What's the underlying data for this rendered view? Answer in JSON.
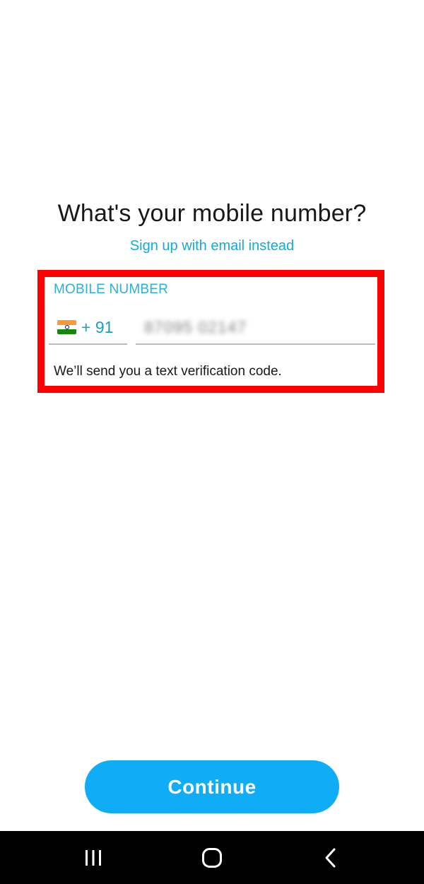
{
  "screen": {
    "title": "What's your mobile number?",
    "email_link": "Sign up with email instead"
  },
  "phone_form": {
    "label": "MOBILE NUMBER",
    "country_flag": "india-flag-icon",
    "country_code": "+ 91",
    "phone_value": "87095 02147",
    "helper_text": "We’ll send you a text verification code."
  },
  "actions": {
    "continue_label": "Continue"
  },
  "navbar": {
    "recent_icon": "recent-apps-icon",
    "home_icon": "home-icon",
    "back_icon": "back-icon"
  },
  "colors": {
    "accent": "#0EADF5",
    "link": "#0FADD3",
    "highlight": "#FF0000",
    "navbar": "#000000"
  }
}
